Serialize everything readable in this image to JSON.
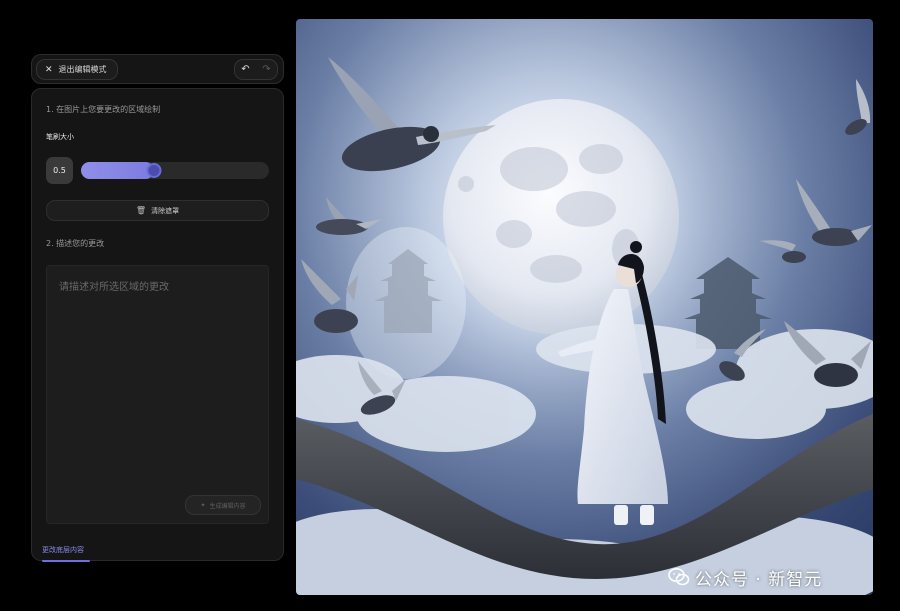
{
  "toolbar": {
    "exit_label": "退出编辑模式",
    "undo_icon": "undo-icon",
    "redo_icon": "redo-icon"
  },
  "step1": {
    "title": "1. 在图片上您要更改的区域绘制",
    "brush_size_label": "笔刷大小",
    "brush_size_value": "0.5",
    "slider_fraction": 0.39,
    "clear_mask_label": "清除遮罩"
  },
  "step2": {
    "title": "2. 描述您的更改",
    "placeholder": "请描述对所选区域的更改",
    "value": "",
    "generate_label": "生成编辑内容"
  },
  "bottom_tab": {
    "label": "更改底层内容"
  },
  "watermark": {
    "text": "公众号 · 新智元"
  },
  "colors": {
    "accent": "#7c7ce0",
    "panel_bg": "#151515",
    "page_bg": "#000000"
  }
}
